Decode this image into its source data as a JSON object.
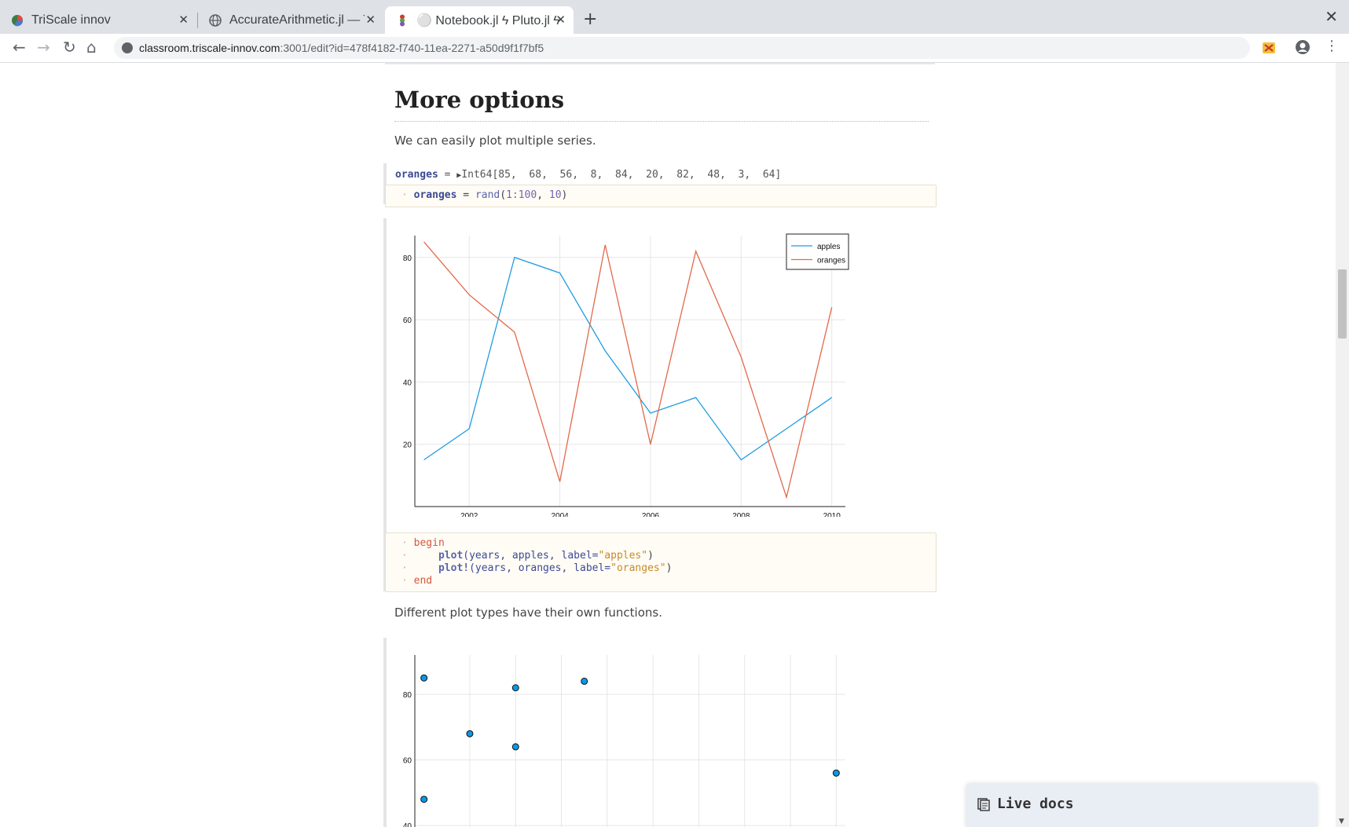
{
  "browser": {
    "tabs": [
      {
        "title": "TriScale innov"
      },
      {
        "title": "AccurateArithmetic.jl — T"
      },
      {
        "title": "⚪ Notebook.jl ϟ Pluto.jl ϟ"
      }
    ],
    "url_host": "classroom.triscale-innov.com",
    "url_path": ":3001/edit?id=478f4182-f740-11ea-2271-a50d9f1f7bf5"
  },
  "notebook": {
    "heading": "More options",
    "intro": "We can easily plot multiple series.",
    "oranges_output": {
      "name": "oranges",
      "eq": " = ",
      "type": "Int64",
      "values": "[85,  68,  56,  8,  84,  20,  82,  48,  3,  64]"
    },
    "oranges_code": {
      "var": "oranges",
      "eq": " = ",
      "fn": "rand",
      "args_open": "(",
      "range": "1:100",
      "comma": ", ",
      "n": "10",
      "args_close": ")"
    },
    "plot_code": {
      "begin": "begin",
      "line1_fn": "plot",
      "line1_args": "(years, apples, label=",
      "line1_str": "\"apples\"",
      "line2_fn": "plot!",
      "line2_args": "(years, oranges, label=",
      "line2_str": "\"oranges\"",
      "close": ")",
      "end": "end"
    },
    "prose2": "Different plot types have their own functions."
  },
  "live_docs": {
    "label": "Live docs"
  },
  "colors": {
    "apples": "#1f9be3",
    "oranges": "#e3694a",
    "scatter": "#0a98e8"
  },
  "chart_data": [
    {
      "type": "line",
      "x": [
        2001,
        2002,
        2003,
        2004,
        2005,
        2006,
        2007,
        2008,
        2009,
        2010
      ],
      "series": [
        {
          "name": "apples",
          "values": [
            15,
            25,
            80,
            75,
            50,
            30,
            35,
            15,
            25,
            35
          ]
        },
        {
          "name": "oranges",
          "values": [
            85,
            68,
            56,
            8,
            84,
            20,
            82,
            48,
            3,
            64
          ]
        }
      ],
      "xticks": [
        "2002",
        "2004",
        "2006",
        "2008",
        "2010"
      ],
      "yticks": [
        "20",
        "40",
        "60",
        "80"
      ],
      "xlim": [
        2000.8,
        2010.3
      ],
      "ylim": [
        0,
        87
      ],
      "grid": true,
      "legend_position": "top-right",
      "title": "",
      "xlabel": "",
      "ylabel": ""
    },
    {
      "type": "scatter",
      "x": [
        2001,
        2002,
        2003,
        2003,
        2004.5,
        2010,
        2001
      ],
      "y": [
        85,
        68,
        82,
        64,
        84,
        56,
        48
      ],
      "yticks": [
        "40",
        "60",
        "80"
      ],
      "xlim": [
        2000.8,
        2010.2
      ],
      "ylim": [
        35,
        92
      ],
      "grid": true,
      "title": "",
      "xlabel": "",
      "ylabel": ""
    }
  ]
}
